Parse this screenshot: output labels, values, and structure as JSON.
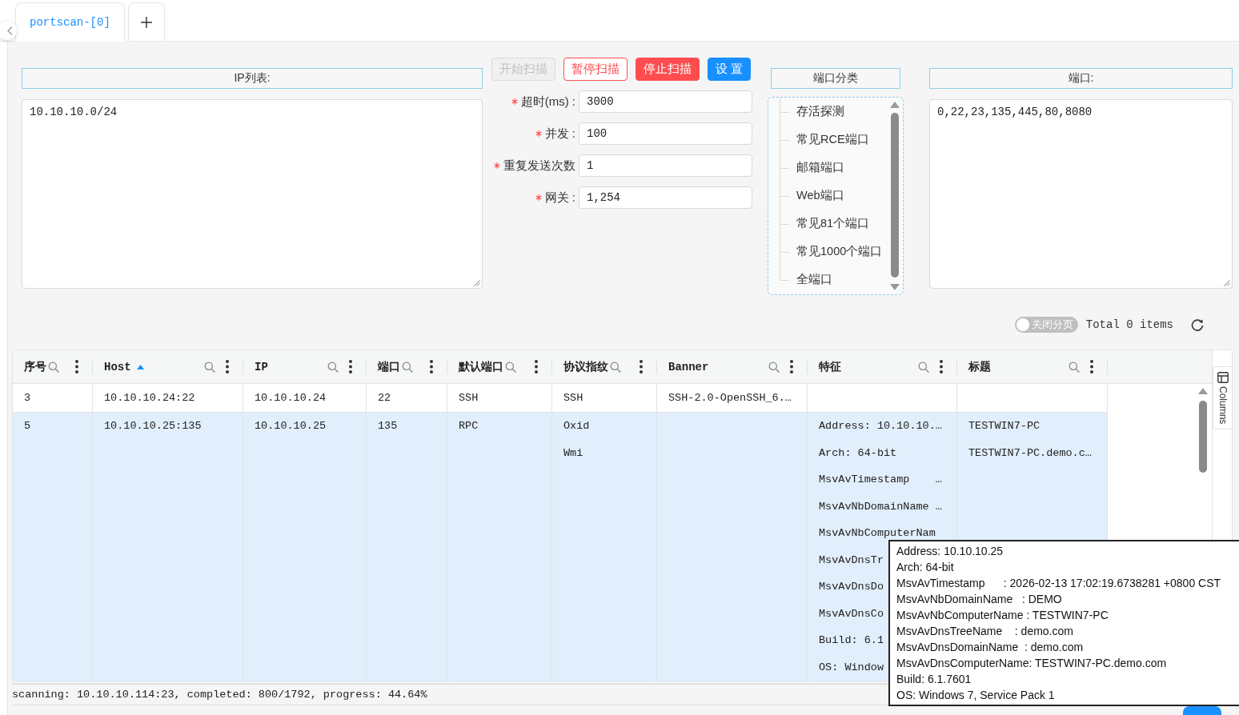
{
  "tabs": [
    {
      "label": "portscan-[0]",
      "selected": true
    }
  ],
  "ip_list": {
    "header": "IP列表:",
    "value": "10.10.10.0/24"
  },
  "buttons": [
    {
      "label": "开始扫描",
      "kind": "default",
      "disabled": true
    },
    {
      "label": "暂停扫描",
      "kind": "danger-outline",
      "disabled": false
    },
    {
      "label": "停止扫描",
      "kind": "danger",
      "disabled": false
    },
    {
      "label": "设 置",
      "kind": "primary",
      "disabled": false
    }
  ],
  "fields": [
    {
      "label": "超时(ms) :",
      "required": true,
      "value": "3000"
    },
    {
      "label": "并发 :",
      "required": true,
      "value": "100"
    },
    {
      "label": "重复发送次数",
      "required": true,
      "value": "1"
    },
    {
      "label": "网关 :",
      "required": true,
      "value": "1,254"
    }
  ],
  "port_categories": {
    "header": "端口分类",
    "items": [
      "存活探测",
      "常见RCE端口",
      "邮箱端口",
      "Web端口",
      "常见81个端口",
      "常见1000个端口",
      "全端口"
    ]
  },
  "ports": {
    "header": "端口:",
    "value": "0,22,23,135,445,80,8080"
  },
  "pagination_toggle": {
    "label": "关闭分页",
    "on": false
  },
  "total": "Total 0 items",
  "table": {
    "columns": [
      {
        "label": "序号",
        "sorted": false
      },
      {
        "label": "Host",
        "sorted": true
      },
      {
        "label": "IP",
        "sorted": false
      },
      {
        "label": "端口",
        "sorted": false
      },
      {
        "label": "默认端口",
        "sorted": false
      },
      {
        "label": "协议指纹",
        "sorted": false
      },
      {
        "label": "Banner",
        "sorted": false
      },
      {
        "label": "特征",
        "sorted": false
      },
      {
        "label": "标题",
        "sorted": false
      }
    ],
    "rows": [
      {
        "selected": false,
        "no": "3",
        "host": "10.10.10.24:22",
        "ip": "10.10.10.24",
        "port": "22",
        "default_port": "SSH",
        "fingerprint": [
          "SSH"
        ],
        "banner": "SSH-2.0-OpenSSH_6.…"
      },
      {
        "selected": true,
        "no": "5",
        "host": "10.10.10.25:135",
        "ip": "10.10.10.25",
        "port": "135",
        "default_port": "RPC",
        "fingerprint": [
          "Oxid",
          "Wmi"
        ],
        "features": [
          "Address: 10.10.10.…",
          "Arch: 64-bit",
          "MsvAvTimestamp    …",
          "MsvAvNbDomainName …",
          "MsvAvNbComputerNam",
          "MsvAvDnsTr",
          "MsvAvDnsDo",
          "MsvAvDnsCo",
          "Build: 6.1",
          "OS: Window"
        ],
        "title": [
          "TESTWIN7-PC",
          "TESTWIN7-PC.demo.c…"
        ]
      }
    ],
    "side_panel": "Columns"
  },
  "tooltip": {
    "lines": [
      "Address: 10.10.10.25",
      "Arch: 64-bit",
      "MsvAvTimestamp      : 2026-02-13 17:02:19.6738281 +0800 CST",
      "MsvAvNbDomainName   : DEMO",
      "MsvAvNbComputerName : TESTWIN7-PC",
      "MsvAvDnsTreeName    : demo.com",
      "MsvAvDnsDomainName  : demo.com",
      "MsvAvDnsComputerName: TESTWIN7-PC.demo.com",
      "Build: 6.1.7601",
      "OS: Windows 7, Service Pack 1"
    ]
  },
  "status_bar": "scanning: 10.10.10.114:23, completed: 800/1792, progress: 44.64%"
}
